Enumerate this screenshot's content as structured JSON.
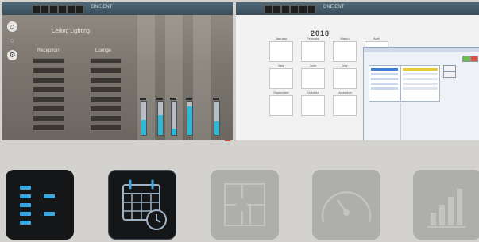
{
  "left_screen": {
    "title": "DNE ENT",
    "heading": "Ceiling Lighting",
    "columns": [
      "Reception",
      "Lounge"
    ]
  },
  "right_screen": {
    "title": "DNE ENT",
    "year": "2018",
    "months": [
      "January",
      "February",
      "March",
      "April",
      "May",
      "June",
      "July",
      "August",
      "September",
      "October",
      "November",
      "December"
    ]
  },
  "feature_icons": [
    {
      "name": "list-icon",
      "state": "active"
    },
    {
      "name": "calendar-clock-icon",
      "state": "active"
    },
    {
      "name": "floor-plan-icon",
      "state": "inactive"
    },
    {
      "name": "gauge-icon",
      "state": "inactive"
    },
    {
      "name": "bar-chart-icon",
      "state": "inactive"
    }
  ],
  "colors": {
    "accent": "#3aa7e0",
    "tile_dark": "#151618",
    "tile_grey": "#aeaeac",
    "background": "#d3d2ce"
  },
  "gauge_levels": [
    0.45,
    0.6,
    0.2,
    0.85,
    0.4
  ]
}
